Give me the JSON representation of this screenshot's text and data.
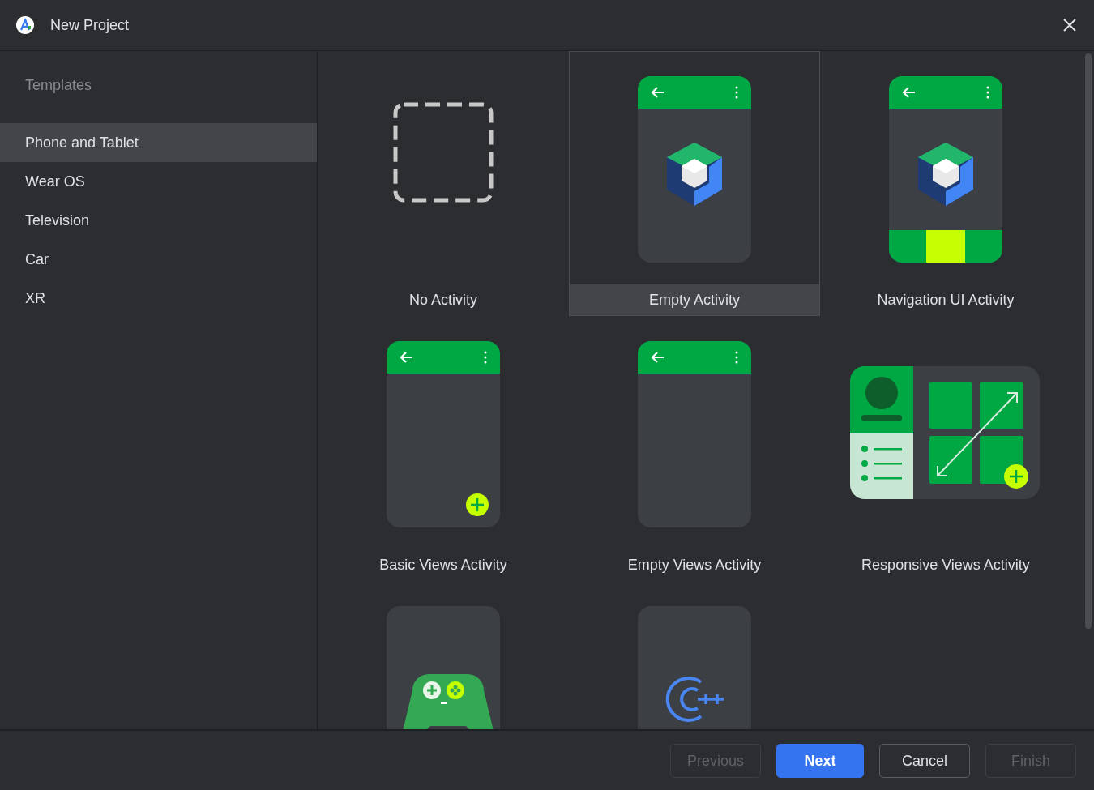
{
  "window": {
    "title": "New Project"
  },
  "sidebar": {
    "header": "Templates",
    "items": [
      {
        "label": "Phone and Tablet",
        "selected": true
      },
      {
        "label": "Wear OS",
        "selected": false
      },
      {
        "label": "Television",
        "selected": false
      },
      {
        "label": "Car",
        "selected": false
      },
      {
        "label": "XR",
        "selected": false
      }
    ]
  },
  "templates": [
    {
      "kind": "none",
      "label": "No Activity",
      "selected": false
    },
    {
      "kind": "empty",
      "label": "Empty Activity",
      "selected": true
    },
    {
      "kind": "navigation",
      "label": "Navigation UI Activity",
      "selected": false
    },
    {
      "kind": "basic",
      "label": "Basic Views Activity",
      "selected": false
    },
    {
      "kind": "empty-views",
      "label": "Empty Views Activity",
      "selected": false
    },
    {
      "kind": "responsive",
      "label": "Responsive Views Activity",
      "selected": false
    },
    {
      "kind": "game",
      "selected": false
    },
    {
      "kind": "native",
      "selected": false
    }
  ],
  "buttons": [
    {
      "label": "Previous",
      "kind": "default",
      "disabled": true
    },
    {
      "label": "Next",
      "kind": "primary",
      "disabled": false
    },
    {
      "label": "Cancel",
      "kind": "default",
      "disabled": false
    },
    {
      "label": "Finish",
      "kind": "default",
      "disabled": true
    }
  ]
}
